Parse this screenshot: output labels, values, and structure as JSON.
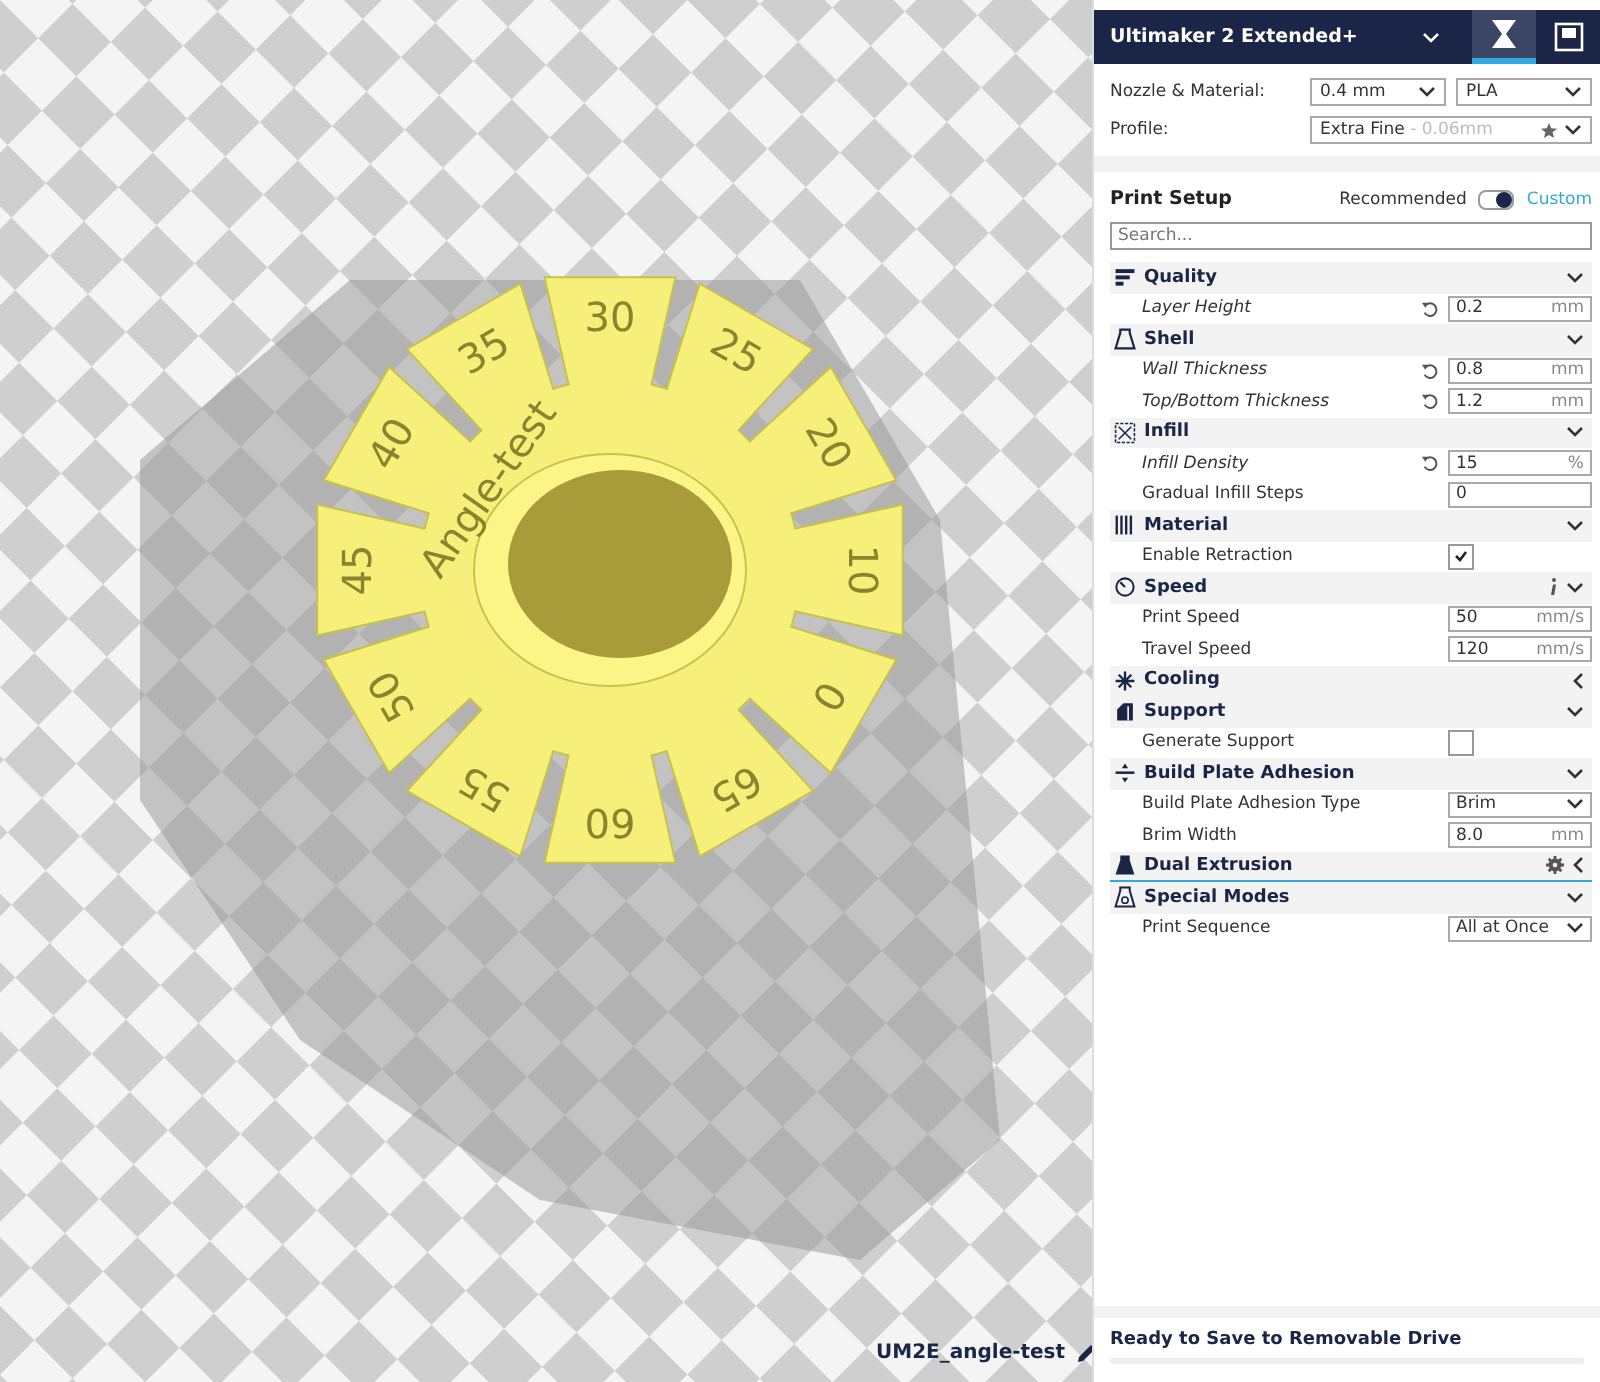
{
  "header": {
    "printer": "Ultimaker 2 Extended+",
    "tabs": [
      {
        "kind": "prepare",
        "selected": true
      },
      {
        "kind": "monitor",
        "selected": false
      }
    ]
  },
  "nozzle_material": {
    "label": "Nozzle & Material:",
    "nozzle": "0.4 mm",
    "material": "PLA"
  },
  "profile": {
    "label": "Profile:",
    "name": "Extra Fine",
    "detail": " - 0.06mm"
  },
  "print_setup": {
    "title": "Print Setup",
    "mode_left": "Recommended",
    "mode_right": "Custom",
    "custom_on": true,
    "search": {
      "placeholder": "Search..."
    }
  },
  "categories": [
    {
      "title": "Quality",
      "expanded": true,
      "settings": [
        {
          "kind": "field",
          "label": "Layer Height",
          "modified": true,
          "value": "0.2",
          "unit": "mm"
        }
      ]
    },
    {
      "title": "Shell",
      "expanded": true,
      "settings": [
        {
          "kind": "field",
          "label": "Wall Thickness",
          "modified": true,
          "value": "0.8",
          "unit": "mm"
        },
        {
          "kind": "field",
          "label": "Top/Bottom Thickness",
          "modified": true,
          "value": "1.2",
          "unit": "mm"
        }
      ]
    },
    {
      "title": "Infill",
      "expanded": true,
      "settings": [
        {
          "kind": "field",
          "label": "Infill Density",
          "modified": true,
          "value": "15",
          "unit": "%"
        },
        {
          "kind": "field",
          "label": "Gradual Infill Steps",
          "modified": false,
          "value": "0"
        }
      ]
    },
    {
      "title": "Material",
      "expanded": true,
      "settings": [
        {
          "kind": "checkbox",
          "label": "Enable Retraction",
          "modified": false,
          "checked": true
        }
      ]
    },
    {
      "title": "Speed",
      "expanded": true,
      "info": true,
      "settings": [
        {
          "kind": "field",
          "label": "Print Speed",
          "modified": false,
          "value": "50",
          "unit": "mm/s"
        },
        {
          "kind": "field",
          "label": "Travel Speed",
          "modified": false,
          "value": "120",
          "unit": "mm/s"
        }
      ]
    },
    {
      "title": "Cooling",
      "expanded": false
    },
    {
      "title": "Support",
      "expanded": true,
      "settings": [
        {
          "kind": "checkbox",
          "label": "Generate Support",
          "modified": false,
          "checked": false
        }
      ]
    },
    {
      "title": "Build Plate Adhesion",
      "expanded": true,
      "settings": [
        {
          "kind": "dropdown",
          "label": "Build Plate Adhesion Type",
          "modified": false,
          "value": "Brim"
        },
        {
          "kind": "field",
          "label": "Brim Width",
          "modified": false,
          "value": "8.0",
          "unit": "mm"
        }
      ]
    },
    {
      "title": "Dual Extrusion",
      "expanded": false,
      "hovered": true
    },
    {
      "title": "Special Modes",
      "expanded": true,
      "settings": [
        {
          "kind": "dropdown",
          "label": "Print Sequence",
          "modified": false,
          "value": "All at Once"
        }
      ]
    }
  ],
  "model": {
    "name": "UM2E_angle-test",
    "engraving": "Angle-test",
    "angle_labels": [
      "35",
      "30",
      "25",
      "20",
      "10",
      "0",
      "65",
      "60",
      "55",
      "50",
      "45",
      "40"
    ]
  },
  "status": {
    "message": "Ready to Save to Removable Drive"
  }
}
